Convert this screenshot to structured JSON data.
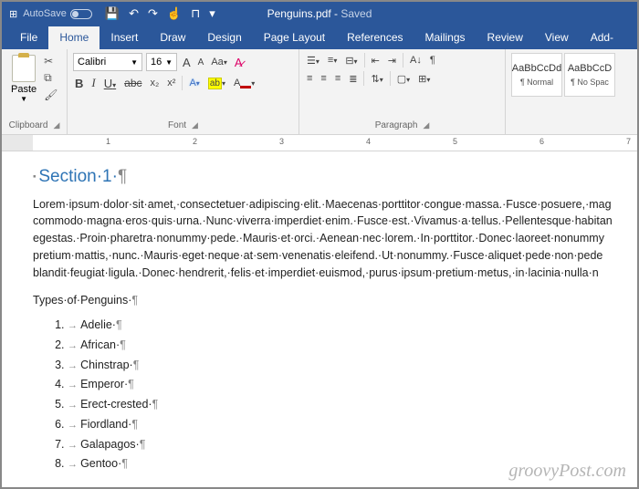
{
  "titlebar": {
    "autosave": "AutoSave",
    "doc_name": "Penguins.pdf",
    "saved": "Saved"
  },
  "qat": {
    "save": "💾",
    "undo": "↶",
    "redo": "↷",
    "touch": "☝",
    "spacing": "⊓",
    "more": "▾"
  },
  "tabs": [
    "File",
    "Home",
    "Insert",
    "Draw",
    "Design",
    "Page Layout",
    "References",
    "Mailings",
    "Review",
    "View",
    "Add-"
  ],
  "active_tab": "Home",
  "ribbon": {
    "clipboard": {
      "paste": "Paste",
      "label": "Clipboard"
    },
    "font": {
      "name": "Calibri",
      "size": "16",
      "grow": "A",
      "shrink": "A",
      "case": "Aa",
      "clear": "⌫",
      "bold": "B",
      "italic": "I",
      "underline": "U",
      "strike": "abc",
      "sub": "x₂",
      "sup": "x²",
      "effects": "A",
      "highlight": "ab",
      "color": "A",
      "label": "Font"
    },
    "paragraph": {
      "label": "Paragraph"
    },
    "styles": [
      {
        "preview": "AaBbCcDd",
        "name": "¶ Normal"
      },
      {
        "preview": "AaBbCcD",
        "name": "¶ No Spac"
      }
    ]
  },
  "ruler_labels": [
    "1",
    "2",
    "3",
    "4",
    "5",
    "6",
    "7"
  ],
  "document": {
    "heading": "Section·1·",
    "body": "Lorem·ipsum·dolor·sit·amet,·consectetuer·adipiscing·elit.·Maecenas·porttitor·congue·massa.·Fusce·posuere,·mag commodo·magna·eros·quis·urna.·Nunc·viverra·imperdiet·enim.·Fusce·est.·Vivamus·a·tellus.·Pellentesque·habitan egestas.·Proin·pharetra·nonummy·pede.·Mauris·et·orci.·Aenean·nec·lorem.·In·porttitor.·Donec·laoreet·nonummy pretium·mattis,·nunc.·Mauris·eget·neque·at·sem·venenatis·eleifend.·Ut·nonummy.·Fusce·aliquet·pede·non·pede blandit·feugiat·ligula.·Donec·hendrerit,·felis·et·imperdiet·euismod,·purus·ipsum·pretium·metus,·in·lacinia·nulla·n",
    "list_title": "Types·of·Penguins·",
    "items": [
      "Adelie·",
      "African·",
      "Chinstrap·",
      "Emperor·",
      "Erect-crested·",
      "Fiordland·",
      "Galapagos·",
      "Gentoo·"
    ]
  },
  "watermark": "groovyPost.com"
}
